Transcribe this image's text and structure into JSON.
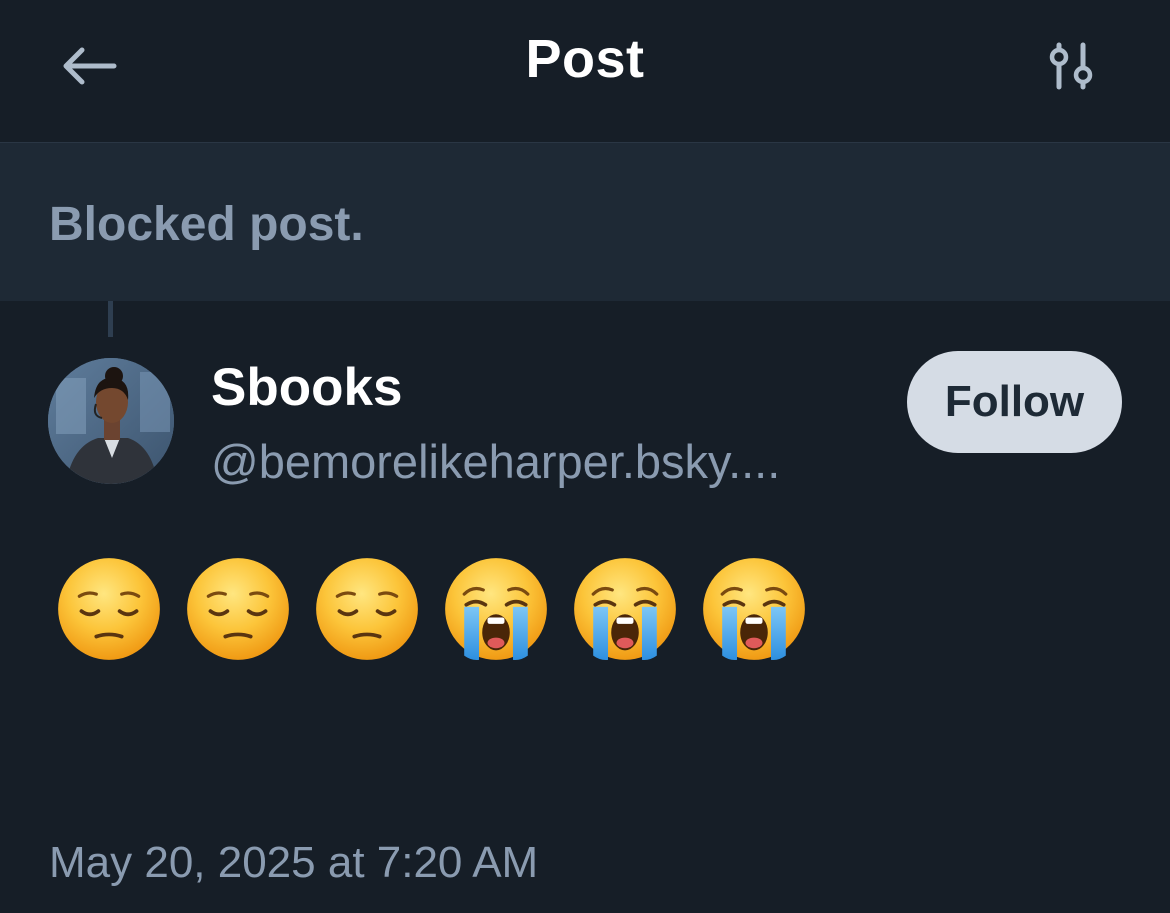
{
  "header": {
    "title": "Post",
    "back_icon": "arrow-left-icon",
    "filter_icon": "sliders-icon"
  },
  "blocked": {
    "text": "Blocked post."
  },
  "author": {
    "display_name": "Sbooks",
    "handle": "@bemorelikeharper.bsky....",
    "follow_label": "Follow"
  },
  "post": {
    "emojis": [
      "pensive-face",
      "pensive-face",
      "pensive-face",
      "loudly-crying-face",
      "loudly-crying-face",
      "loudly-crying-face"
    ],
    "timestamp": "May 20, 2025 at 7:20 AM"
  },
  "colors": {
    "background": "#161e27",
    "blocked_background": "#1e2935",
    "muted_text": "#8a9bb0",
    "follow_button": "#d5dce5"
  }
}
